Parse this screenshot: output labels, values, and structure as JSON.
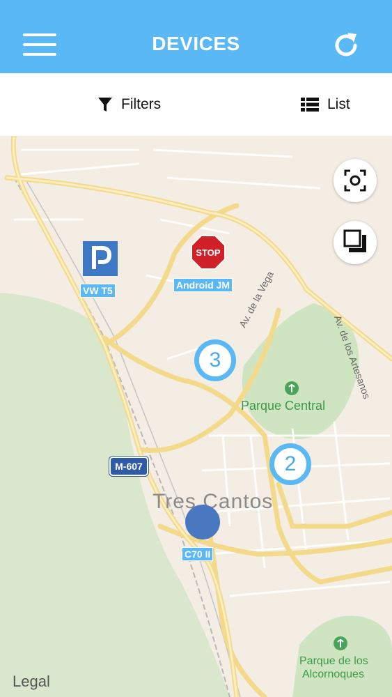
{
  "header": {
    "title": "DEVICES"
  },
  "toolbar": {
    "filters_label": "Filters",
    "list_label": "List"
  },
  "map": {
    "clusters": [
      {
        "count": "3"
      },
      {
        "count": "2"
      }
    ],
    "devices": [
      {
        "label": "VW T5",
        "icon": "parking-icon"
      },
      {
        "label": "Android JM",
        "icon": "stop-sign-icon",
        "sign_text": "STOP"
      },
      {
        "label": "C70 II",
        "icon": "device-dot-icon"
      }
    ],
    "road_shield": "M-607",
    "city": "Tres Cantos",
    "streets": {
      "vega": "Av. de la Vega",
      "artesanos": "Av. de los Artesanos"
    },
    "parks": {
      "central": "Parque Central",
      "alcornoques_line1": "Parque de los",
      "alcornoques_line2": "Alcornoques"
    },
    "legal": "Legal"
  },
  "colors": {
    "accent": "#5ab8f5",
    "device_dot": "#4a78c0",
    "park_text": "#3a9a4a"
  }
}
